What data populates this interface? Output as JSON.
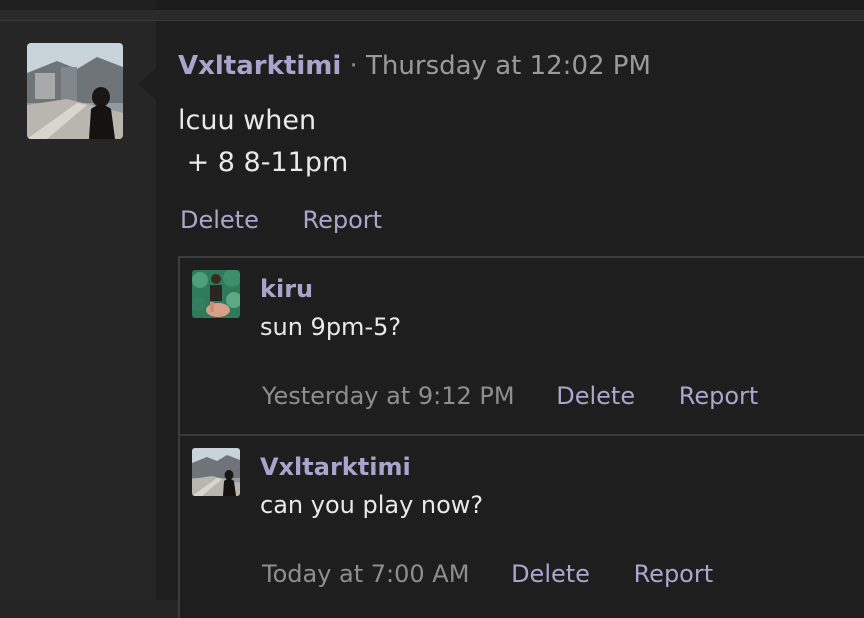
{
  "post": {
    "author": "Vxltarktimi",
    "separator": "·",
    "timestamp": "Thursday at 12:02 PM",
    "body_lines": [
      "lcuu when",
      " + 8 8-11pm"
    ],
    "actions": {
      "delete": "Delete",
      "report": "Report"
    }
  },
  "replies": [
    {
      "author": "kiru",
      "text": "sun 9pm-5?",
      "timestamp": "Yesterday at 9:12 PM",
      "actions": {
        "delete": "Delete",
        "report": "Report"
      }
    },
    {
      "author": "Vxltarktimi",
      "text": "can you play now?",
      "timestamp": "Today at 7:00 AM",
      "actions": {
        "delete": "Delete",
        "report": "Report"
      }
    }
  ],
  "colors": {
    "author": "#a9a4cc",
    "link": "#aaa6cc",
    "timestamp": "#9a9a9a",
    "text": "#e9e9e9",
    "background": "#1e1e1e"
  }
}
